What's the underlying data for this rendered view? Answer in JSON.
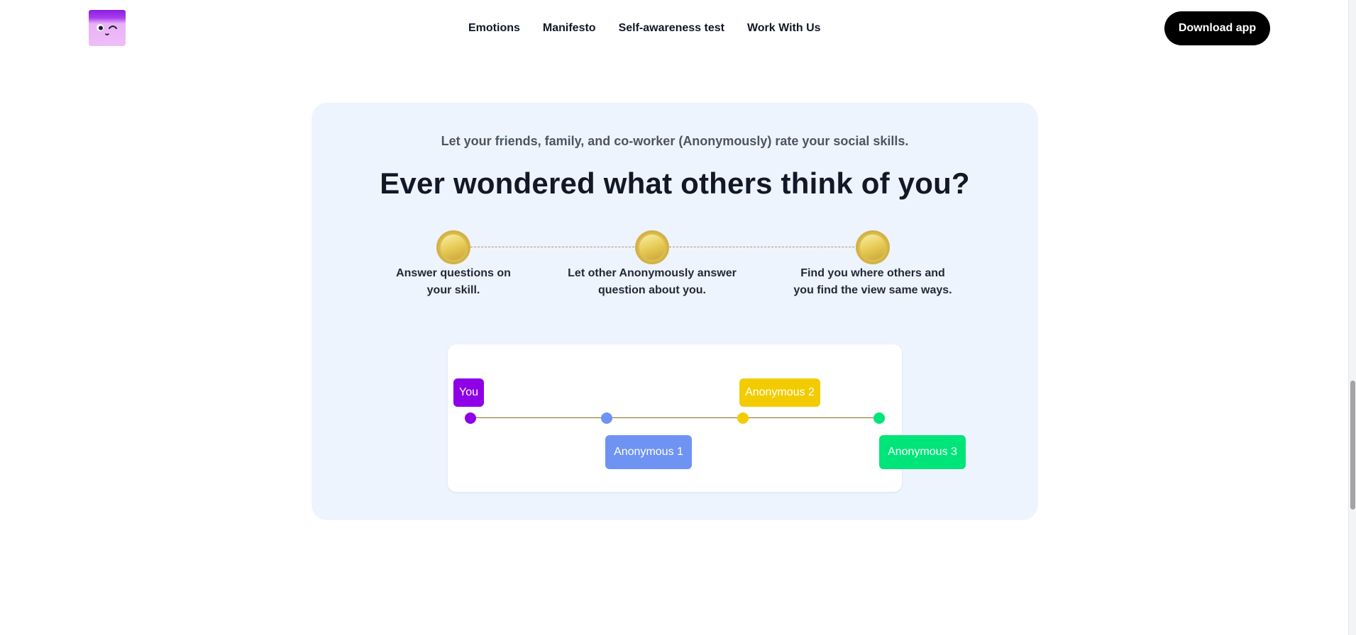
{
  "header": {
    "nav": [
      "Emotions",
      "Manifesto",
      "Self-awareness test",
      "Work With Us"
    ],
    "download_label": "Download app"
  },
  "card": {
    "subtitle": "Let your friends, family, and co-worker (Anonymously) rate your social skills.",
    "headline": "Ever wondered what others think of you?",
    "steps": [
      {
        "line1": "Answer questions on",
        "line2": "your skill."
      },
      {
        "line1": "Let other Anonymously answer",
        "line2": "question about you."
      },
      {
        "line1": "Find you where others and",
        "line2": "you find the view same ways."
      }
    ]
  },
  "rating_scale": {
    "tags": [
      {
        "label": "You",
        "color": "#8e00e6"
      },
      {
        "label": "Anonymous 1",
        "color": "#6f93f2"
      },
      {
        "label": "Anonymous 2",
        "color": "#f2cc00"
      },
      {
        "label": "Anonymous 3",
        "color": "#00e57a"
      }
    ],
    "track_color": "#8a6a1c"
  },
  "colors": {
    "accent_purple": "#8e00e6",
    "card_bg": "#eef4fd",
    "button_bg": "#000000"
  },
  "icons": {
    "logo": "winking-face-logo",
    "step_marker": "gold-coin-icon"
  }
}
